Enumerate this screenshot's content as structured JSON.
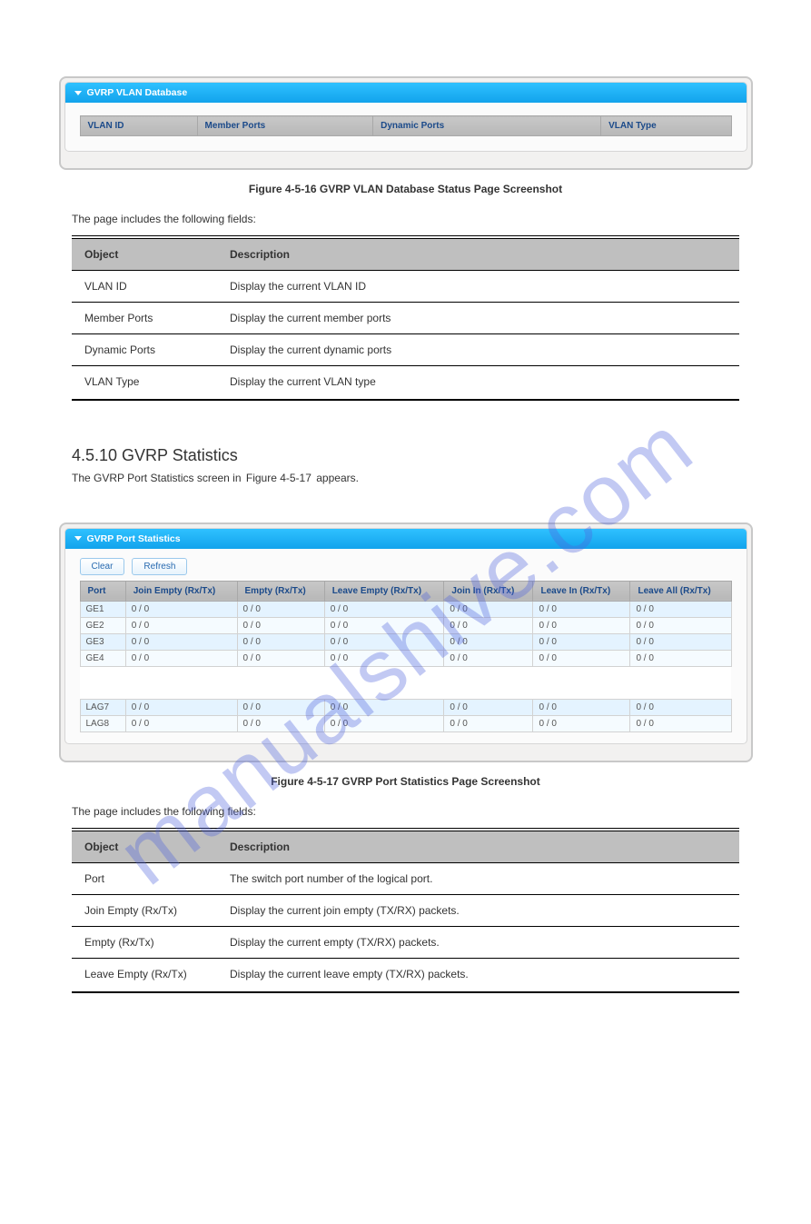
{
  "watermark": "manualshive.com",
  "card1": {
    "title": "GVRP VLAN Database",
    "cols": [
      "VLAN ID",
      "Member Ports",
      "Dynamic Ports",
      "VLAN Type"
    ]
  },
  "fig1_caption": "Figure 4-5-16 GVRP VLAN Database Status Page Screenshot",
  "caption_fields": "The page includes the following fields:",
  "desc1": {
    "head": [
      "Object",
      "Description"
    ],
    "rows": [
      [
        "VLAN ID",
        "Display the current VLAN ID"
      ],
      [
        "Member Ports",
        "Display the current member ports"
      ],
      [
        "Dynamic Ports",
        "Display the current dynamic ports"
      ],
      [
        "VLAN Type",
        "Display the current VLAN type"
      ]
    ]
  },
  "section2": {
    "heading": "4.5.10 GVRP Statistics",
    "text": "The GVRP Port Statistics screen in",
    "text2": " appears.",
    "figref": "Figure 4-5-17"
  },
  "card2": {
    "title": "GVRP Port Statistics",
    "btn_clear": "Clear",
    "btn_refresh": "Refresh",
    "cols": [
      "Port",
      "Join Empty (Rx/Tx)",
      "Empty (Rx/Tx)",
      "Leave Empty (Rx/Tx)",
      "Join In (Rx/Tx)",
      "Leave In (Rx/Tx)",
      "Leave All (Rx/Tx)"
    ],
    "rows_top": [
      [
        "GE1",
        "0 / 0",
        "0 / 0",
        "0 / 0",
        "0 / 0",
        "0 / 0",
        "0 / 0"
      ],
      [
        "GE2",
        "0 / 0",
        "0 / 0",
        "0 / 0",
        "0 / 0",
        "0 / 0",
        "0 / 0"
      ],
      [
        "GE3",
        "0 / 0",
        "0 / 0",
        "0 / 0",
        "0 / 0",
        "0 / 0",
        "0 / 0"
      ],
      [
        "GE4",
        "0 / 0",
        "0 / 0",
        "0 / 0",
        "0 / 0",
        "0 / 0",
        "0 / 0"
      ]
    ],
    "rows_bottom": [
      [
        "LAG7",
        "0 / 0",
        "0 / 0",
        "0 / 0",
        "0 / 0",
        "0 / 0",
        "0 / 0"
      ],
      [
        "LAG8",
        "0 / 0",
        "0 / 0",
        "0 / 0",
        "0 / 0",
        "0 / 0",
        "0 / 0"
      ]
    ]
  },
  "fig2_caption": "Figure 4-5-17 GVRP Port Statistics Page Screenshot",
  "desc2": {
    "head": [
      "Object",
      "Description"
    ],
    "rows": [
      [
        "Port",
        "The switch port number of the logical port."
      ],
      [
        "Join Empty (Rx/Tx)",
        "Display the current join empty (TX/RX) packets."
      ],
      [
        "Empty (Rx/Tx)",
        "Display the current empty (TX/RX) packets."
      ],
      [
        "Leave Empty (Rx/Tx)",
        "Display the current leave empty (TX/RX) packets."
      ]
    ]
  }
}
